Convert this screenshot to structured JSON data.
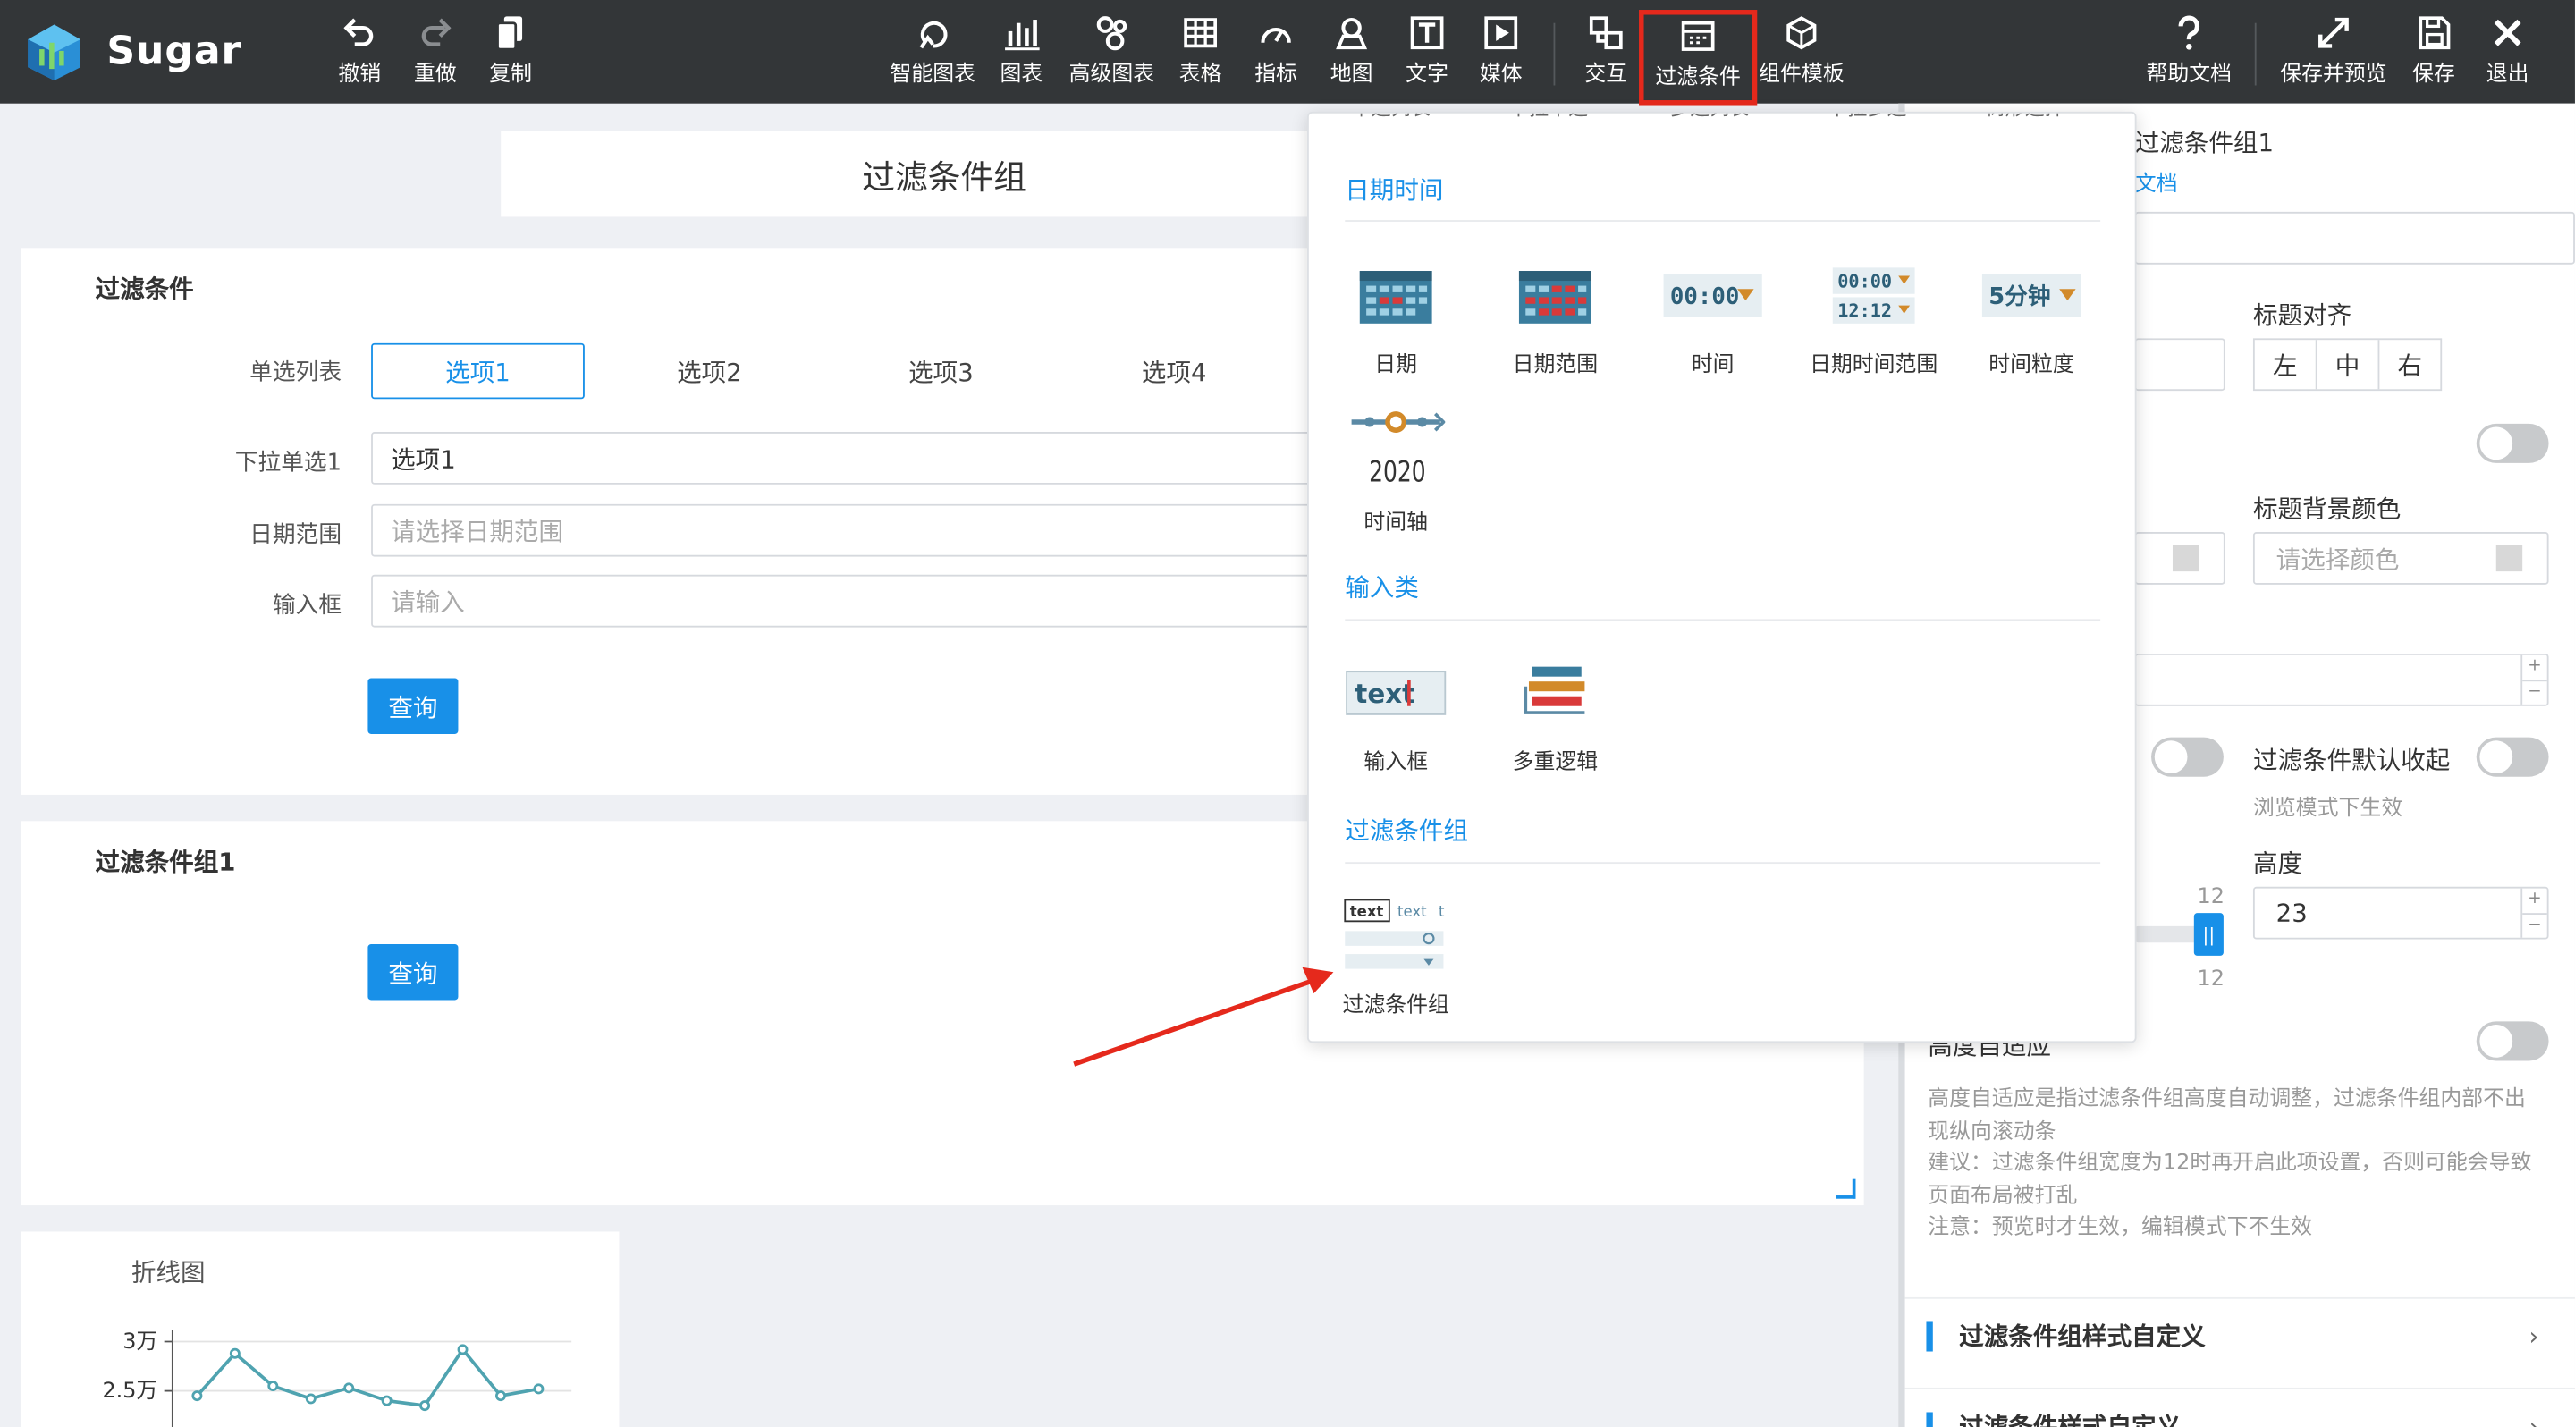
{
  "app": {
    "brand": "Sugar"
  },
  "toolbar": {
    "left": [
      {
        "label": "撤销",
        "icon": "undo-icon"
      },
      {
        "label": "重做",
        "icon": "redo-icon"
      },
      {
        "label": "复制",
        "icon": "copy-icon"
      }
    ],
    "center": [
      {
        "label": "智能图表",
        "icon": "smart-chart-icon"
      },
      {
        "label": "图表",
        "icon": "bar-chart-icon"
      },
      {
        "label": "高级图表",
        "icon": "advanced-chart-icon"
      },
      {
        "label": "表格",
        "icon": "table-icon"
      },
      {
        "label": "指标",
        "icon": "gauge-icon"
      },
      {
        "label": "地图",
        "icon": "map-pin-icon"
      },
      {
        "label": "文字",
        "icon": "text-icon"
      },
      {
        "label": "媒体",
        "icon": "media-icon"
      },
      {
        "label": "交互",
        "icon": "interaction-icon"
      },
      {
        "label": "过滤条件",
        "icon": "filter-calendar-icon"
      },
      {
        "label": "组件模板",
        "icon": "template-cube-icon"
      }
    ],
    "right": [
      {
        "label": "帮助文档",
        "icon": "help-icon"
      },
      {
        "label": "保存并预览",
        "icon": "expand-icon"
      },
      {
        "label": "保存",
        "icon": "save-icon"
      },
      {
        "label": "退出",
        "icon": "close-icon"
      }
    ],
    "highlight_color": "#e5291c"
  },
  "canvas": {
    "group_title": "过滤条件组",
    "filter_section": {
      "title": "过滤条件",
      "radio_label": "单选列表",
      "options": [
        "选项1",
        "选项2",
        "选项3",
        "选项4"
      ],
      "selected_option": "选项1",
      "dropdown_label": "下拉单选1",
      "dropdown_value": "选项1",
      "date_label": "日期范围",
      "date_placeholder": "请选择日期范围",
      "input_label": "输入框",
      "input_placeholder": "请输入",
      "query_button": "查询"
    },
    "group1_section": {
      "title": "过滤条件组1",
      "query_button": "查询"
    },
    "line_chart_card": {
      "title": "折线图",
      "chart_data": {
        "type": "line",
        "title": "折线图",
        "y_ticks": [
          "3万",
          "2.5万"
        ],
        "ylim": [
          25000,
          30000
        ],
        "series": [
          {
            "values": [
              24500,
              28800,
              25500,
              24200,
              25300,
              24000,
              23500,
              29200,
              24500,
              25200
            ]
          }
        ]
      }
    },
    "accent_color": "#1890e8"
  },
  "dropdown": {
    "cut_top_labels": [
      "单选列表",
      "下拉单选",
      "多选列表",
      "下拉多选",
      "树形选择"
    ],
    "sections": [
      {
        "title": "日期时间",
        "items": [
          {
            "label": "日期",
            "icon": "calendar-icon"
          },
          {
            "label": "日期范围",
            "icon": "calendar-range-icon"
          },
          {
            "label": "时间",
            "icon": "time-icon",
            "icon_text": "00:00"
          },
          {
            "label": "日期时间范围",
            "icon": "datetime-range-icon",
            "icon_text_a": "00:00",
            "icon_text_b": "12:12"
          },
          {
            "label": "时间粒度",
            "icon": "time-granularity-icon",
            "icon_text": "5分钟"
          },
          {
            "label": "时间轴",
            "icon": "timeline-icon",
            "icon_text": "2020"
          }
        ]
      },
      {
        "title": "输入类",
        "items": [
          {
            "label": "输入框",
            "icon": "text-input-icon",
            "icon_text": "text"
          },
          {
            "label": "多重逻辑",
            "icon": "multi-logic-icon"
          }
        ]
      },
      {
        "title": "过滤条件组",
        "items": [
          {
            "label": "过滤条件组",
            "icon": "filter-group-icon",
            "icon_text_a": "text",
            "icon_text_b": "text",
            "icon_text_c": "t"
          }
        ]
      }
    ]
  },
  "right_panel": {
    "component_name": "过滤条件组1",
    "doc_link": "文档",
    "title_align_label": "标题对齐",
    "align_options": [
      "左",
      "中",
      "右"
    ],
    "title_bg_label": "标题背景颜色",
    "color_placeholder": "请选择颜色",
    "collapse_label": "过滤条件默认收起",
    "collapse_note": "浏览模式下生效",
    "height_label": "高度",
    "height_value": "23",
    "slider_value": "12",
    "slider_max": "12",
    "auto_height_label": "高度自适应",
    "notes": [
      "高度自适应是指过滤条件组高度自动调整，过滤条件组内部不出现纵向滚动条",
      "建议：过滤条件组宽度为12时再开启此项设置，否则可能会导致页面布局被打乱",
      "注意：预览时才生效，编辑模式下不生效"
    ],
    "sections": [
      "过滤条件组样式自定义",
      "过滤条件样式自定义"
    ],
    "step_plus": "+",
    "step_minus": "−"
  }
}
